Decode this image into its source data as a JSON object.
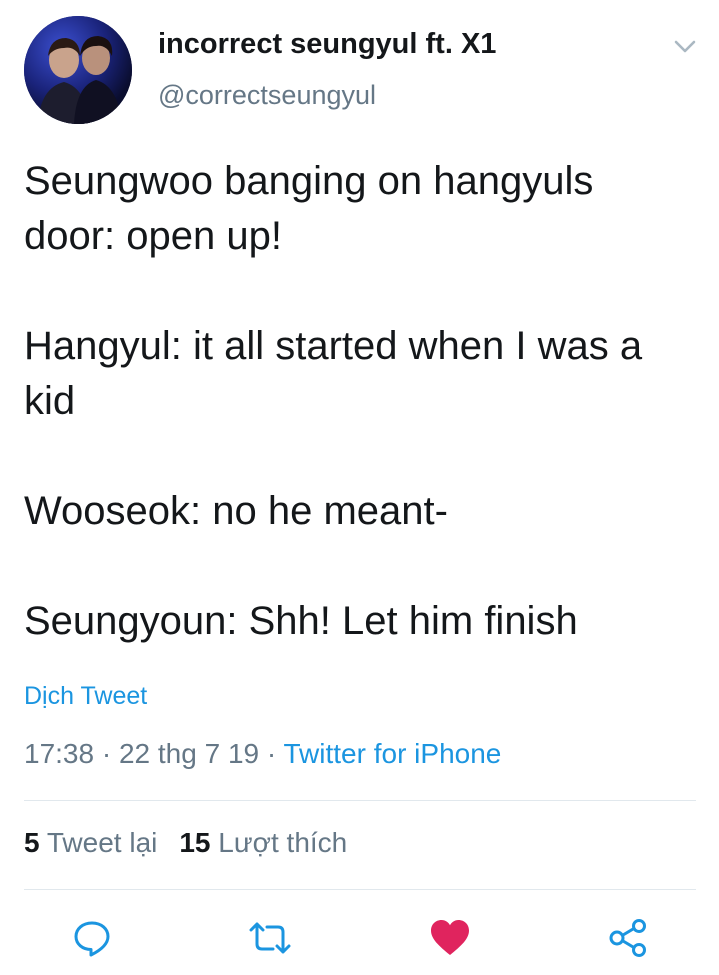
{
  "author": {
    "display_name": "incorrect seungyul ft. X1",
    "handle": "@correctseungyul"
  },
  "tweet": {
    "paragraphs": [
      "Seungwoo banging on hangyuls door: open up!",
      "Hangyul: it all started when I was a kid",
      "Wooseok: no he meant-",
      "Seungyoun: Shh! Let him finish"
    ],
    "translate_label": "Dịch Tweet",
    "time": "17:38",
    "date": "22 thg 7 19",
    "separator": " · ",
    "source": "Twitter for iPhone"
  },
  "stats": {
    "retweets_count": "5",
    "retweets_label": "Tweet lại",
    "likes_count": "15",
    "likes_label": "Lượt thích"
  },
  "actions": {
    "reply_icon": "comment-bubble-icon",
    "retweet_icon": "retweet-arrows-icon",
    "like_icon": "heart-icon",
    "share_icon": "share-nodes-icon",
    "liked": true
  },
  "colors": {
    "text": "#14171a",
    "secondary": "#657786",
    "link": "#1b95e0",
    "like": "#e0245e",
    "divider": "#e1e8ed"
  }
}
